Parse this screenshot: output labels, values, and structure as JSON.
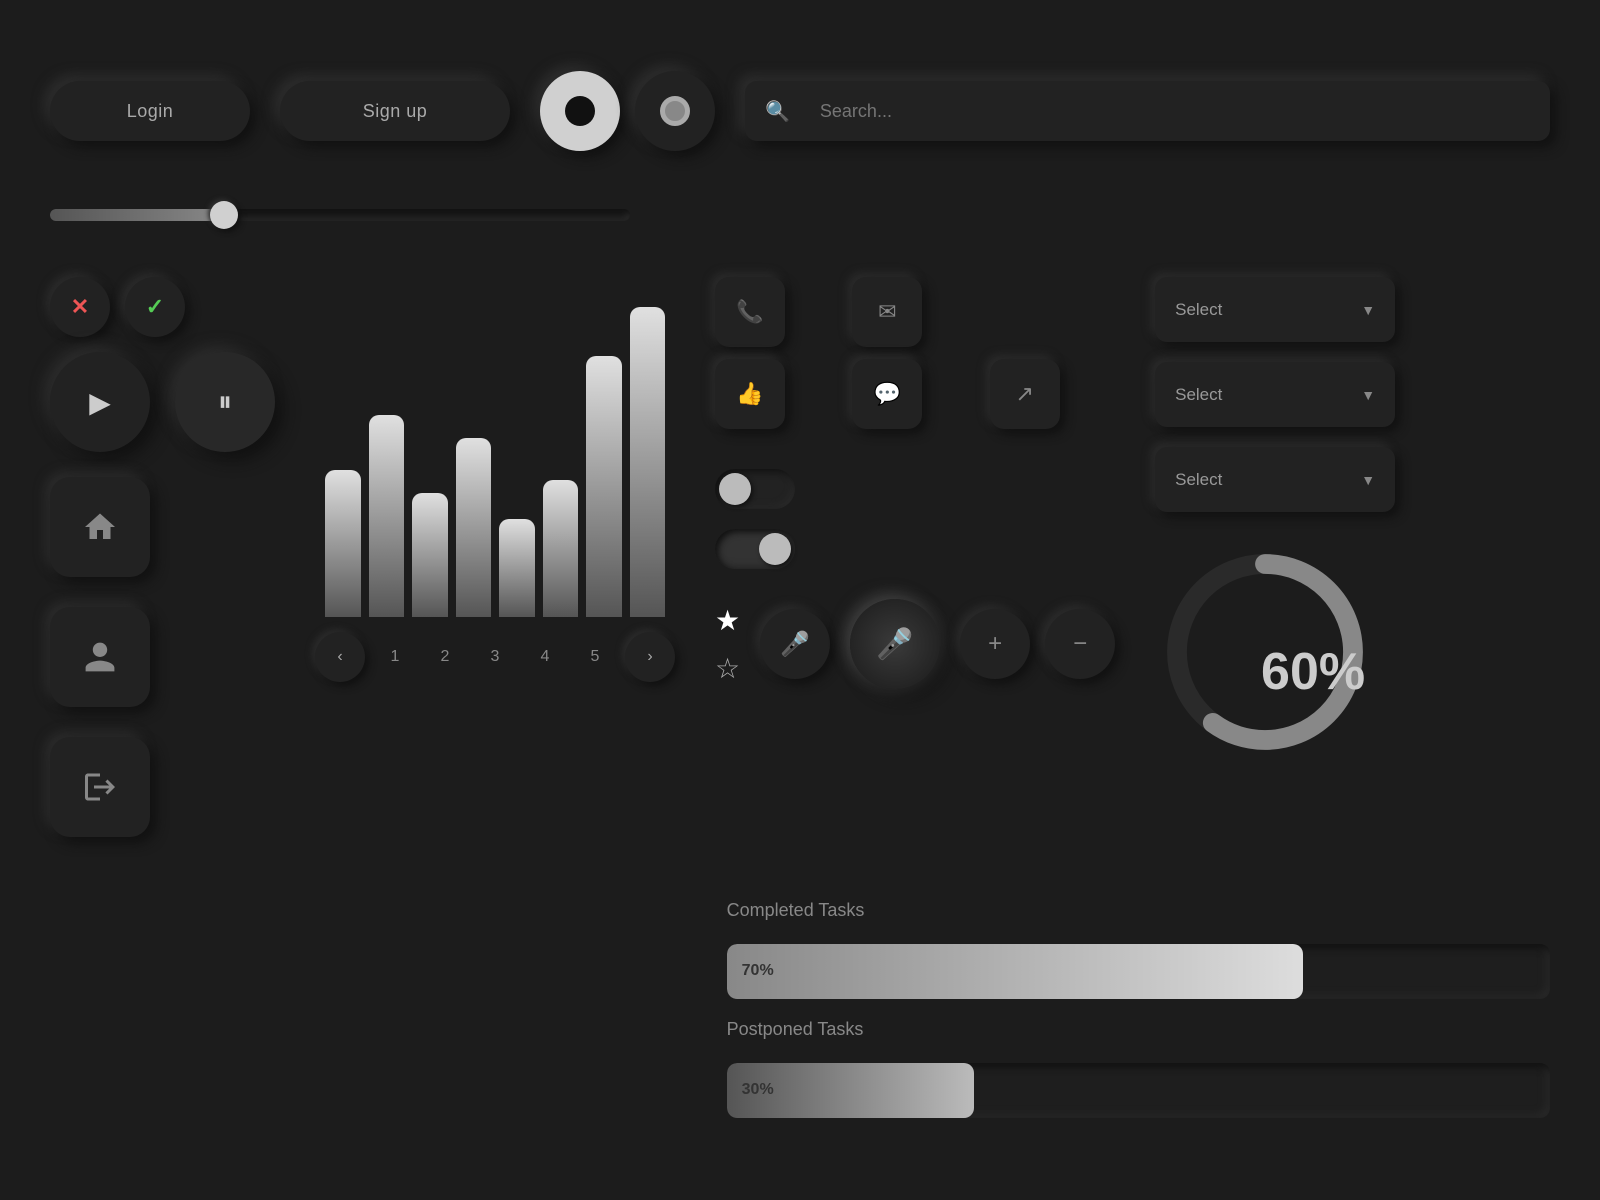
{
  "buttons": {
    "login": "Login",
    "signup": "Sign up",
    "search_placeholder": "Search...",
    "select1": "Select",
    "select2": "Select",
    "select3": "Select"
  },
  "pagination": {
    "pages": [
      "1",
      "2",
      "3",
      "4",
      "5"
    ]
  },
  "chart": {
    "bars": [
      45,
      62,
      38,
      55,
      30,
      42,
      80,
      95
    ]
  },
  "progress": {
    "completed_label": "Completed Tasks",
    "completed_value": "70%",
    "completed_pct": 70,
    "postponed_label": "Postponed Tasks",
    "postponed_value": "30%",
    "postponed_pct": 30
  },
  "circular": {
    "percent": "60%"
  }
}
